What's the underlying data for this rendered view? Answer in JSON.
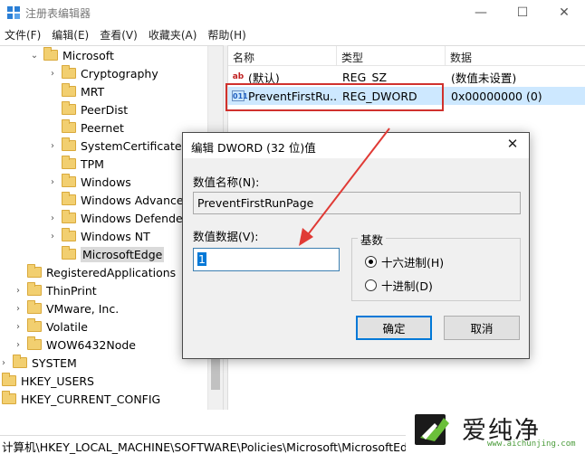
{
  "window": {
    "title": "注册表编辑器"
  },
  "menu": [
    "文件(F)",
    "编辑(E)",
    "查看(V)",
    "收藏夹(A)",
    "帮助(H)"
  ],
  "tree": {
    "items": [
      {
        "label": "Microsoft",
        "expand": "⌄"
      },
      {
        "label": "Cryptography",
        "expand": "›"
      },
      {
        "label": "MRT",
        "expand": ""
      },
      {
        "label": "PeerDist",
        "expand": ""
      },
      {
        "label": "Peernet",
        "expand": ""
      },
      {
        "label": "SystemCertificates",
        "expand": "›"
      },
      {
        "label": "TPM",
        "expand": ""
      },
      {
        "label": "Windows",
        "expand": "›"
      },
      {
        "label": "Windows Advanced",
        "expand": ""
      },
      {
        "label": "Windows Defender",
        "expand": "›"
      },
      {
        "label": "Windows NT",
        "expand": "›"
      },
      {
        "label": "MicrosoftEdge",
        "expand": ""
      },
      {
        "label": "RegisteredApplications",
        "expand": ""
      },
      {
        "label": "ThinPrint",
        "expand": "›"
      },
      {
        "label": "VMware, Inc.",
        "expand": "›"
      },
      {
        "label": "Volatile",
        "expand": "›"
      },
      {
        "label": "WOW6432Node",
        "expand": "›"
      },
      {
        "label": "SYSTEM",
        "expand": "›"
      },
      {
        "label": "HKEY_USERS",
        "expand": "›"
      },
      {
        "label": "HKEY_CURRENT_CONFIG",
        "expand": "›"
      }
    ]
  },
  "list": {
    "headers": {
      "name": "名称",
      "type": "类型",
      "data": "数据"
    },
    "rows": [
      {
        "icon": "ab",
        "name": "(默认)",
        "type": "REG_SZ",
        "data": "(数值未设置)"
      },
      {
        "icon": "011",
        "name": "PreventFirstRu...",
        "type": "REG_DWORD",
        "data": "0x00000000 (0)"
      }
    ]
  },
  "status": {
    "path": "计算机\\HKEY_LOCAL_MACHINE\\SOFTWARE\\Policies\\Microsoft\\MicrosoftEdge"
  },
  "dialog": {
    "title": "编辑 DWORD (32 位)值",
    "name_label": "数值名称(N):",
    "name_value": "PreventFirstRunPage",
    "data_label": "数值数据(V):",
    "data_value": "1",
    "base_label": "基数",
    "hex_label": "十六进制(H)",
    "dec_label": "十进制(D)",
    "ok_label": "确定",
    "cancel_label": "取消"
  },
  "watermark": {
    "brand": "爱纯净",
    "url": "www.aichunjing.com"
  },
  "colors": {
    "selection": "#cde8ff",
    "highlight_box": "#d0312d",
    "arrow": "#e03a35",
    "accent": "#0078d7"
  }
}
